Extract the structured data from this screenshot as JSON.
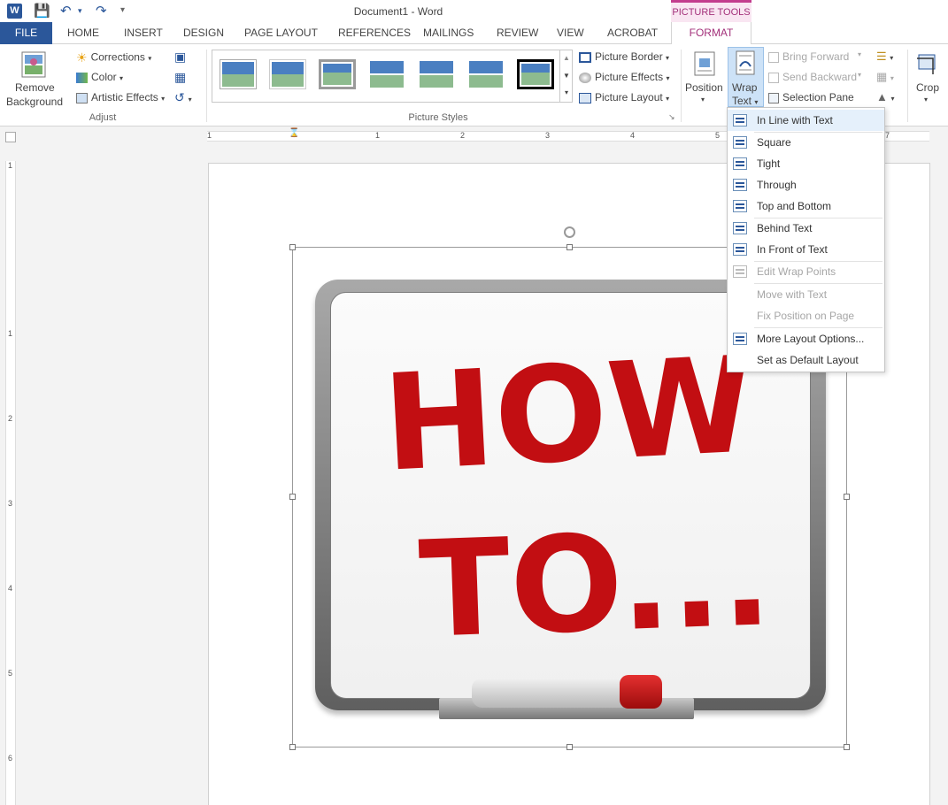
{
  "app": {
    "document_title": "Document1 - Word",
    "contextual_tab_group": "PICTURE TOOLS"
  },
  "tabs": [
    "FILE",
    "HOME",
    "INSERT",
    "DESIGN",
    "PAGE LAYOUT",
    "REFERENCES",
    "MAILINGS",
    "REVIEW",
    "VIEW",
    "ACROBAT",
    "FORMAT"
  ],
  "ribbon": {
    "remove_background": [
      "Remove",
      "Background"
    ],
    "corrections": "Corrections",
    "color": "Color",
    "artistic_effects": "Artistic Effects",
    "adjust_label": "Adjust",
    "picture_border": "Picture Border",
    "picture_effects": "Picture Effects",
    "picture_layout": "Picture Layout",
    "picture_styles_label": "Picture Styles",
    "position": "Position",
    "wrap_text": [
      "Wrap",
      "Text"
    ],
    "bring_forward": "Bring Forward",
    "send_backward": "Send Backward",
    "selection_pane": "Selection Pane",
    "crop": "Crop"
  },
  "ruler": {
    "horizontal": [
      "1",
      "1",
      "2",
      "3",
      "4",
      "5",
      "7"
    ],
    "vertical": [
      "1",
      "1",
      "2",
      "3",
      "4",
      "5",
      "6"
    ]
  },
  "wrap_menu": [
    {
      "label": "In Line with Text",
      "enabled": true,
      "highlighted": true
    },
    {
      "label": "Square",
      "enabled": true
    },
    {
      "label": "Tight",
      "enabled": true
    },
    {
      "label": "Through",
      "enabled": true
    },
    {
      "label": "Top and Bottom",
      "enabled": true
    },
    {
      "label": "Behind Text",
      "enabled": true
    },
    {
      "label": "In Front of Text",
      "enabled": true
    },
    {
      "label": "Edit Wrap Points",
      "enabled": false
    },
    {
      "label": "Move with Text",
      "enabled": false
    },
    {
      "label": "Fix Position on Page",
      "enabled": false
    },
    {
      "label": "More Layout Options...",
      "enabled": true
    },
    {
      "label": "Set as Default Layout",
      "enabled": true
    }
  ],
  "picture": {
    "line1": "HOW",
    "line2": "TO...",
    "ink_color": "#c20e12"
  }
}
